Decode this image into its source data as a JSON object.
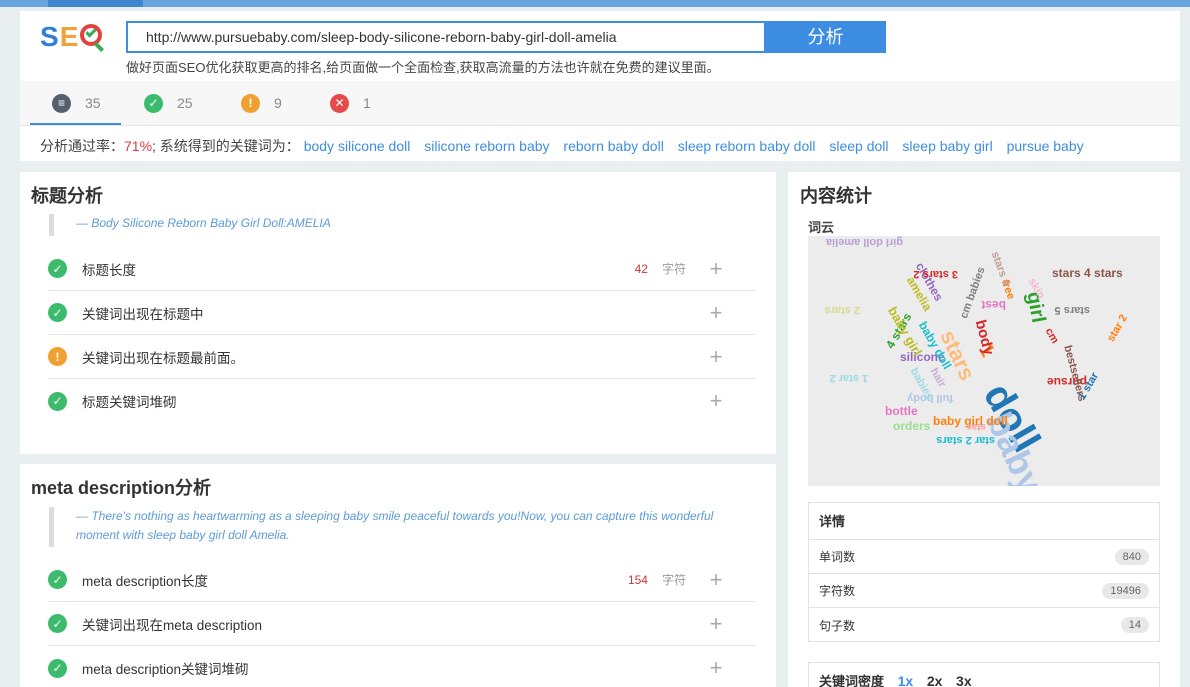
{
  "header": {
    "logo": {
      "s": "S",
      "e": "E",
      "o": "O"
    },
    "url_value": "http://www.pursuebaby.com/sleep-body-silicone-reborn-baby-girl-doll-amelia",
    "analyze_label": "分析",
    "subtitle": "做好页面SEO优化获取更高的排名,给页面做一个全面检查,获取高流量的方法也许就在免费的建议里面。"
  },
  "stats": {
    "total": "35",
    "passed": "25",
    "warnings": "9",
    "errors": "1"
  },
  "rate": {
    "prefix": "分析通过率：",
    "percent": "71%",
    "suffix": "; 系统得到的关键词为：",
    "keywords": [
      "body silicone doll",
      "silicone reborn baby",
      "reborn baby doll",
      "sleep reborn baby doll",
      "sleep doll",
      "sleep baby girl",
      "pursue baby"
    ]
  },
  "title_panel": {
    "heading": "标题分析",
    "quote": "— Body Silicone Reborn Baby Girl Doll:AMELIA",
    "rows": [
      {
        "status": "ok",
        "label": "标题长度",
        "value": "42",
        "unit": "字符"
      },
      {
        "status": "ok",
        "label": "关键词出现在标题中"
      },
      {
        "status": "warn",
        "label": "关键词出现在标题最前面。"
      },
      {
        "status": "ok",
        "label": "标题关键词堆砌"
      }
    ]
  },
  "meta_panel": {
    "heading": "meta description分析",
    "quote": "— There's nothing as heartwarming as a sleeping baby smile peaceful towards you!Now, you can capture this wonderful moment with sleep baby girl doll Amelia.",
    "rows": [
      {
        "status": "ok",
        "label": "meta description长度",
        "value": "154",
        "unit": "字符"
      },
      {
        "status": "ok",
        "label": "关键词出现在meta description"
      },
      {
        "status": "ok",
        "label": "meta description关键词堆砌"
      }
    ]
  },
  "side": {
    "heading": "内容统计",
    "cloud_label": "词云",
    "cloud_words": [
      {
        "t": "girl doll amelia",
        "c": "#b7a0d8"
      },
      {
        "t": "stars 4 stars",
        "c": "#8c564b"
      },
      {
        "t": "doll",
        "c": "#1f77b4"
      },
      {
        "t": "baby",
        "c": "#aec7e8"
      },
      {
        "t": "stars",
        "c": "#ffbb78"
      },
      {
        "t": "1",
        "c": "#ff7f0e"
      },
      {
        "t": "girl",
        "c": "#2ca02c"
      },
      {
        "t": "body",
        "c": "#d62728"
      },
      {
        "t": "silicone",
        "c": "#9467bd"
      },
      {
        "t": "pursue",
        "c": "#d62728"
      },
      {
        "t": "baby girl doll",
        "c": "#ff7f0e"
      },
      {
        "t": "bottle",
        "c": "#e377c2"
      },
      {
        "t": "orders",
        "c": "#98df8a"
      },
      {
        "t": "star 2 stars",
        "c": "#17becf"
      },
      {
        "t": "1 star 2",
        "c": "#9edae5"
      },
      {
        "t": "4 stars",
        "c": "#2ca02c"
      },
      {
        "t": "baby girl",
        "c": "#bcbd22"
      },
      {
        "t": "baby doll",
        "c": "#17becf"
      },
      {
        "t": "clothes",
        "c": "#9467bd"
      },
      {
        "t": "2 stars",
        "c": "#dbdb8d"
      },
      {
        "t": "3 stars 2",
        "c": "#d62728"
      },
      {
        "t": "free",
        "c": "#ff7f0e"
      },
      {
        "t": "best",
        "c": "#e377c2"
      },
      {
        "t": "stars 5",
        "c": "#7f7f7f"
      },
      {
        "t": "bestsellers",
        "c": "#8c564b"
      },
      {
        "t": "star 2",
        "c": "#ff7f0e"
      },
      {
        "t": "cm",
        "c": "#d62728"
      },
      {
        "t": "full body",
        "c": "#aec7e8"
      },
      {
        "t": "hair",
        "c": "#c5b0d5"
      },
      {
        "t": "babies",
        "c": "#9edae5"
      },
      {
        "t": "cm babies",
        "c": "#7f7f7f"
      },
      {
        "t": "1 star",
        "c": "#1f77b4"
      },
      {
        "t": "star",
        "c": "#ff9896"
      },
      {
        "t": "amelia",
        "c": "#bcbd22"
      },
      {
        "t": "stars 4",
        "c": "#c49c94"
      },
      {
        "t": "skin",
        "c": "#f7b6d2"
      }
    ],
    "details_heading": "详情",
    "details": [
      {
        "label": "单词数",
        "value": "840"
      },
      {
        "label": "字符数",
        "value": "19496"
      },
      {
        "label": "句子数",
        "value": "14"
      }
    ],
    "density_heading": "关键词密度",
    "density_options": [
      "1x",
      "2x",
      "3x"
    ],
    "colors": {
      "accent": "#3d8ee2",
      "ok": "#3dbb6d",
      "warn": "#f0a030",
      "error": "#e64a4a"
    }
  }
}
